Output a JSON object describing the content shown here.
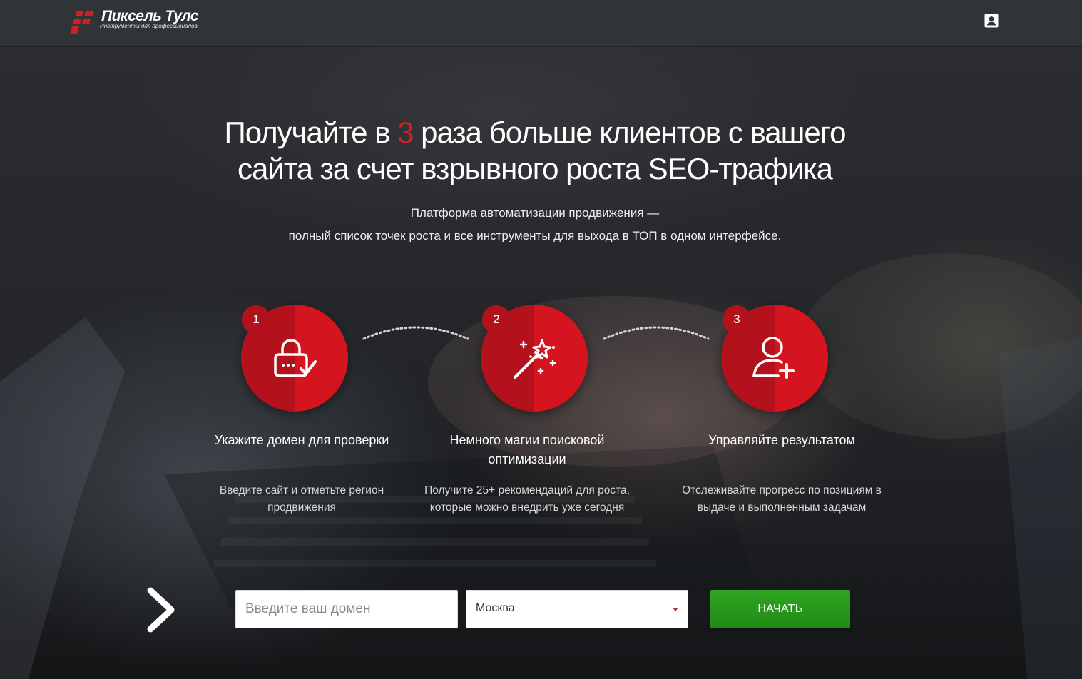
{
  "header": {
    "logo_name": "Пиксель Тулс",
    "logo_tagline": "Инструменты для профессионалов"
  },
  "hero": {
    "headline_part1": "Получайте в ",
    "headline_highlight": "3",
    "headline_part2": " раза больше клиентов с вашего сайта за счет взрывного роста SEO-трафика",
    "subtitle_line1": "Платформа автоматизации продвижения —",
    "subtitle_line2": "полный список точек роста и все инструменты для выхода в ТОП в одном интерфейсе."
  },
  "steps": [
    {
      "number": "1",
      "icon": "lock-check-icon",
      "title": "Укажите домен для проверки",
      "description": "Введите сайт и отметьте регион продвижения"
    },
    {
      "number": "2",
      "icon": "magic-wand-icon",
      "title": "Немного магии поисковой оптимизации",
      "description": "Получите 25+ рекомендаций для роста, которые можно внедрить уже сегодня"
    },
    {
      "number": "3",
      "icon": "user-add-icon",
      "title": "Управляйте результатом",
      "description": "Отслеживайте прогресс по позициям в выдаче и выполненным задачам"
    }
  ],
  "form": {
    "domain_placeholder": "Введите ваш домен",
    "domain_value": "",
    "region_value": "Москва",
    "start_label": "НАЧАТЬ"
  },
  "colors": {
    "accent_red": "#cf1f27",
    "step_red": "#d4141f",
    "start_green": "#2ea51f",
    "navbar": "#303437"
  }
}
